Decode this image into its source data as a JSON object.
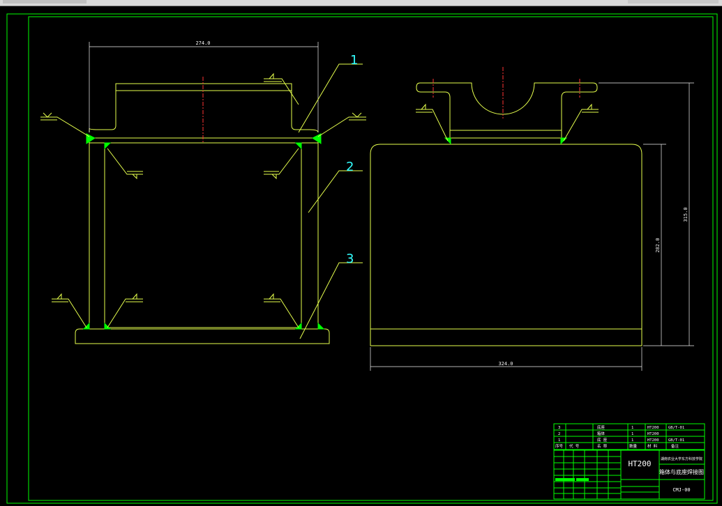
{
  "colors": {
    "frame": "#00ff00",
    "outline": "#e6ff4d",
    "dimension": "#f2f2f2",
    "leader": "#e6ff4d",
    "callout": "#33ffff",
    "centerline": "#ff3333",
    "weld": "#00ff00",
    "title_text": "#ffffff"
  },
  "drawing": {
    "callouts": [
      "1",
      "2",
      "3"
    ],
    "dimensions": {
      "front_width": "274.0",
      "side_width": "324.0",
      "side_height_inner": "282.0",
      "side_height_total": "315.0"
    }
  },
  "title_block": {
    "material": "HT200",
    "drawing_title": "箱体与底座焊接图",
    "drawing_number": "CMJ-00",
    "school": "湖南农业大学东方科技学院",
    "parts_list": [
      {
        "no": "3",
        "name": "底座",
        "qty": "1",
        "material": "HT200",
        "note": "GB/T-01"
      },
      {
        "no": "2",
        "name": "箱体",
        "qty": "1",
        "material": "HT200",
        "note": ""
      },
      {
        "no": "1",
        "name": "底 座",
        "qty": "1",
        "material": "HT200",
        "note": "GB/T-01"
      }
    ],
    "header": {
      "no": "序号",
      "code": "代 号",
      "name": "名 称",
      "qty": "数量",
      "material": "材 料",
      "note": "备注"
    }
  }
}
